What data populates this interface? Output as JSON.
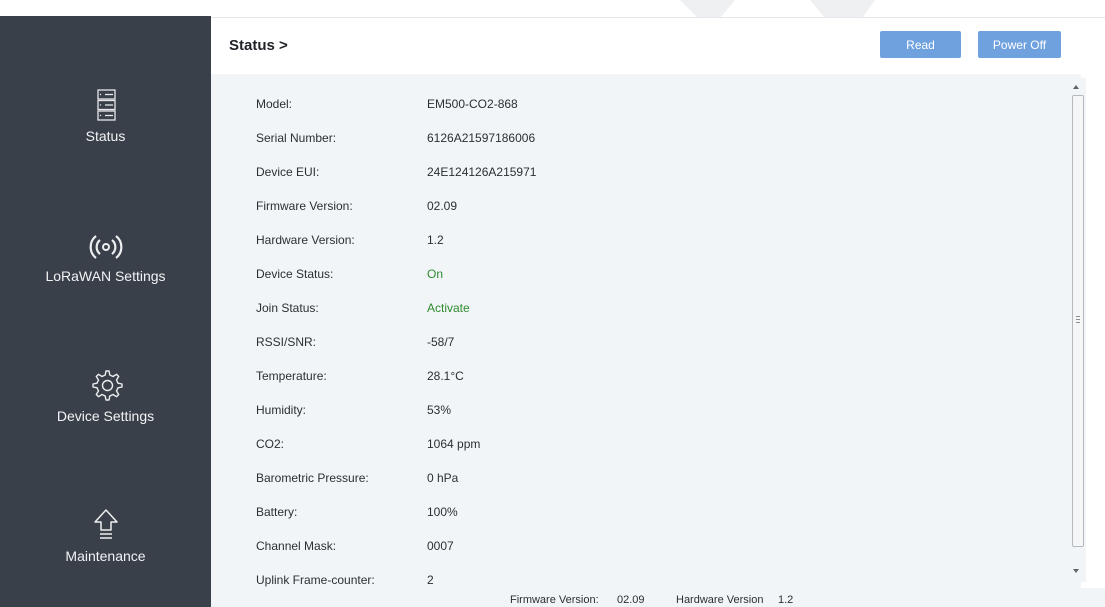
{
  "sidebar": {
    "items": [
      {
        "label": "Status",
        "icon": "server-icon"
      },
      {
        "label": "LoRaWAN Settings",
        "icon": "wireless-signal-icon"
      },
      {
        "label": "Device Settings",
        "icon": "gear-icon"
      },
      {
        "label": "Maintenance",
        "icon": "upload-icon"
      }
    ]
  },
  "header": {
    "title": "Status >",
    "read_label": "Read",
    "power_off_label": "Power Off"
  },
  "status_fields": [
    {
      "label": "Model:",
      "value": "EM500-CO2-868"
    },
    {
      "label": "Serial Number:",
      "value": "6126A21597186006"
    },
    {
      "label": "Device EUI:",
      "value": "24E124126A215971"
    },
    {
      "label": "Firmware Version:",
      "value": "02.09"
    },
    {
      "label": "Hardware Version:",
      "value": "1.2"
    },
    {
      "label": "Device Status:",
      "value": "On"
    },
    {
      "label": "Join Status:",
      "value": "Activate"
    },
    {
      "label": "RSSI/SNR:",
      "value": "-58/7"
    },
    {
      "label": "Temperature:",
      "value": "28.1°C"
    },
    {
      "label": "Humidity:",
      "value": "53%"
    },
    {
      "label": "CO2:",
      "value": "1064 ppm"
    },
    {
      "label": "Barometric Pressure:",
      "value": "0 hPa"
    },
    {
      "label": "Battery:",
      "value": "100%"
    },
    {
      "label": "Channel Mask:",
      "value": "0007"
    },
    {
      "label": "Uplink Frame-counter:",
      "value": "2"
    }
  ],
  "footer": {
    "firmware_label": "Firmware Version:",
    "firmware_value": "02.09",
    "hardware_label": "Hardware Version",
    "hardware_value": "1.2"
  },
  "colors": {
    "sidebar_bg": "#3a4049",
    "accent_button": "#6fa1df",
    "content_bg": "#f2f5f7",
    "status_green": "#2e8b2e"
  }
}
